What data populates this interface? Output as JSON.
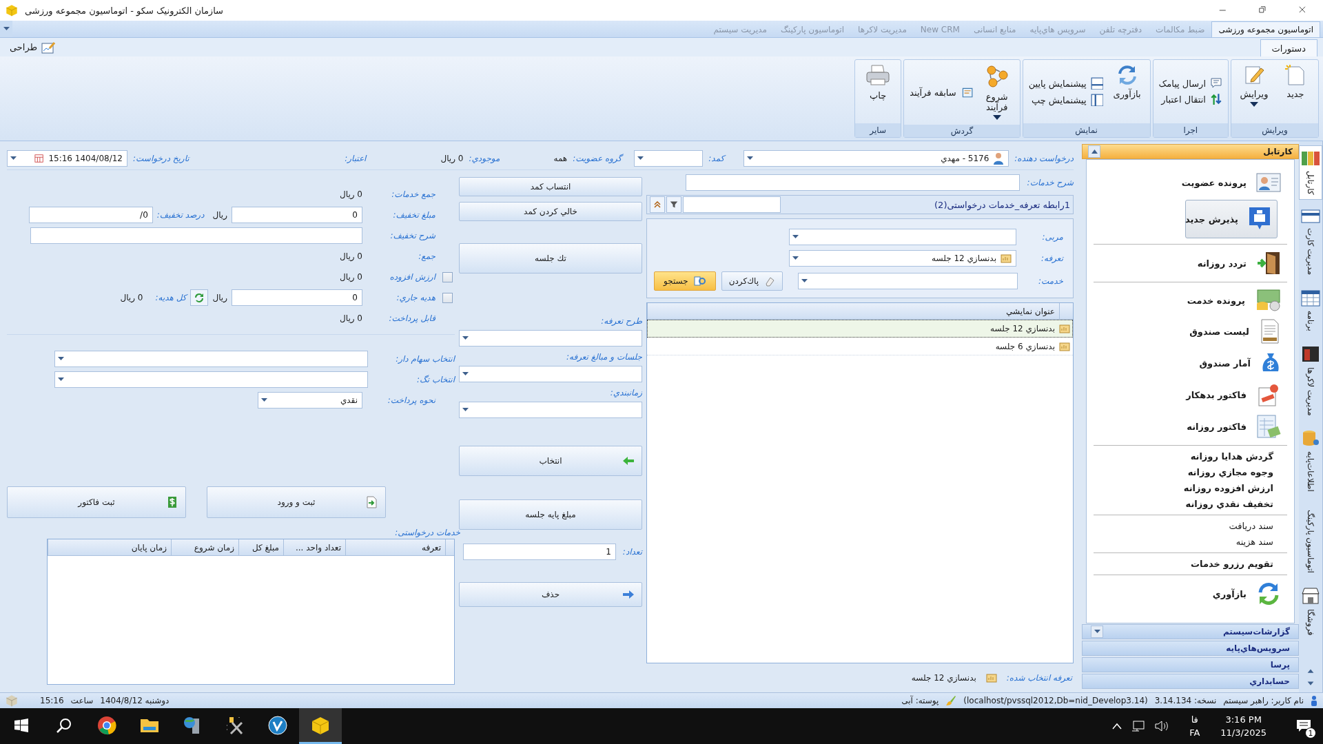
{
  "window": {
    "title": "سازمان الکترونیک سکو - اتوماسیون مجموعه ورزشی"
  },
  "module_tabs": [
    {
      "label": "اتوماسیون مجموعه ورزشی",
      "selected": true
    },
    {
      "label": "ضبط مکالمات",
      "selected": false
    },
    {
      "label": "دفترچه تلفن",
      "selected": false
    },
    {
      "label": "سرویس هاي‌پایه",
      "selected": false
    },
    {
      "label": "منابع انسانی",
      "selected": false
    },
    {
      "label": "New CRM",
      "selected": false
    },
    {
      "label": "مدیریت لاکرها",
      "selected": false
    },
    {
      "label": "اتوماسیون پارکینگ",
      "selected": false
    },
    {
      "label": "مدیریت سیستم",
      "selected": false
    }
  ],
  "ribbon_tabs": [
    {
      "label": "دستورات",
      "selected": true
    }
  ],
  "design_button": "طراحی",
  "ribbon_groups": [
    {
      "title": "ویرایش",
      "items": [
        {
          "kind": "large",
          "label": "جدید",
          "menu": false
        },
        {
          "kind": "large",
          "label": "ویرایش",
          "menu": true
        }
      ]
    },
    {
      "title": "اجرا",
      "items": [
        {
          "kind": "small",
          "label": "ارسال پیامک"
        },
        {
          "kind": "small",
          "label": "انتقال اعتبار"
        }
      ]
    },
    {
      "title": "نمایش",
      "items": [
        {
          "kind": "large",
          "label": "بازآوری",
          "menu": false
        },
        {
          "kind": "small",
          "label": "پیشنمایش پایین"
        },
        {
          "kind": "small",
          "label": "پیشنمایش چپ"
        }
      ]
    },
    {
      "title": "گردش",
      "items": [
        {
          "kind": "large",
          "label": "شروع فرآیند",
          "menu": true
        },
        {
          "kind": "small",
          "label": "سابقه فرآیند"
        }
      ]
    },
    {
      "title": "سایر",
      "items": [
        {
          "kind": "large",
          "label": "چاپ",
          "menu": false
        }
      ]
    }
  ],
  "request": {
    "requester": {
      "label": "درخواست دهنده:",
      "value": "5176 - مهدي"
    },
    "locker": {
      "label": "کمد:"
    },
    "group": {
      "label": "گروه عضویت:",
      "value": "همه"
    },
    "balance": {
      "label": "موجودي:",
      "value": "0 ریال"
    },
    "credit": {
      "label": "اعتبار:"
    },
    "date": {
      "label": "تاریخ درخواست:",
      "value": "1404/08/12 15:16"
    },
    "description": {
      "label": "شرح خدمات:"
    }
  },
  "tariff_grid": {
    "title": "1رابطه تعرفه_خدمات درخواستی(2)",
    "filters": [
      {
        "label": "مربی:"
      },
      {
        "label": "تعرفه:",
        "value": "بدنسازي 12 جلسه"
      },
      {
        "label": "خدمت:"
      }
    ],
    "clear_button": "پاك‌کردن",
    "search_button": "جستجو",
    "column": "عنوان نمایشي",
    "rows": [
      {
        "title": "بدنسازي 12 جلسه",
        "selected": true
      },
      {
        "title": "بدنسازي 6 جلسه",
        "selected": false
      }
    ],
    "selected_label": "تعرفه انتخاب شده:",
    "selected_value": "بدنسازي 12 جلسه"
  },
  "actions": {
    "assign_locker": "انتساب کمد",
    "empty_locker": "خالي کردن کمد",
    "single_session": "تك جلسه",
    "tariff_plan": {
      "label": "طرح تعرفه:"
    },
    "sessions": {
      "label": "جلسات و مبالغ تعرفه:"
    },
    "schedule": {
      "label": "زمانبندي:"
    },
    "select": "انتخاب",
    "base_price": "مبلغ پایه جلسه",
    "count": {
      "label": "تعداد:",
      "value": "1"
    },
    "delete": "حذف"
  },
  "invoice": {
    "services_total": {
      "label": "جمع خدمات:",
      "value": "0 ریال"
    },
    "discount": {
      "label": "مبلغ تخفیف:",
      "value": "0",
      "unit": "ریال"
    },
    "discount_percent": {
      "label": "درصد تخفیف:",
      "value": "0/"
    },
    "discount_note": {
      "label": "شرح تخفیف:"
    },
    "total": {
      "label": "جمع:",
      "value": "0 ریال"
    },
    "vat": {
      "label": "ارزش افزوده",
      "value": "0 ریال",
      "checked": false
    },
    "gift": {
      "label": "هدیه جاري:",
      "value": "0",
      "unit": "ریال",
      "checked": false
    },
    "gift_total": {
      "label": "کل هدیه:",
      "value": "0 ریال"
    },
    "payable": {
      "label": "قابل پرداخت:",
      "value": "0 ریال"
    },
    "shareholder": {
      "label": "انتخاب سهام دار:"
    },
    "tag": {
      "label": "انتخاب تگ:"
    },
    "payment": {
      "label": "نحوه پرداخت:",
      "value": "نقدي"
    },
    "buttons": [
      "ثبت و ورود",
      "ثبت فاکتور"
    ],
    "services_label": "خدمات درخواستی:",
    "columns": [
      "تعرفه",
      "تعداد واحد ...",
      "مبلغ کل",
      "زمان شروع",
      "زمان پایان"
    ]
  },
  "sidebar": {
    "title": "کارتابل",
    "groups": [
      {
        "items": [
          {
            "kind": "large",
            "label": "پرونده عضویت",
            "selected": false
          },
          {
            "kind": "large",
            "label": "پذیرش جدید",
            "selected": true
          }
        ]
      },
      {
        "items": [
          {
            "kind": "large",
            "label": "تردد روزانه",
            "selected": false
          }
        ]
      },
      {
        "items": [
          {
            "kind": "large",
            "label": "پرونده خدمت",
            "selected": false
          },
          {
            "kind": "large",
            "label": "لیست صندوق",
            "selected": false
          },
          {
            "kind": "large",
            "label": "آمار صندوق",
            "selected": false
          },
          {
            "kind": "large",
            "label": "فاکتور بدهکار",
            "selected": false
          },
          {
            "kind": "large",
            "label": "فاکتور روزانه",
            "selected": false
          }
        ]
      },
      {
        "items": [
          {
            "kind": "bold",
            "label": "گردش هدایا روزانه",
            "selected": false
          },
          {
            "kind": "bold",
            "label": "وجوه مجازي روزانه",
            "selected": false
          },
          {
            "kind": "bold",
            "label": "ارزش افزوده روزانه",
            "selected": false
          },
          {
            "kind": "bold",
            "label": "تخفیف نقدي روزانه",
            "selected": false
          }
        ]
      },
      {
        "items": [
          {
            "kind": "plain",
            "label": "سند دریافت",
            "selected": false
          },
          {
            "kind": "plain",
            "label": "سند هزینه",
            "selected": false
          }
        ]
      },
      {
        "items": [
          {
            "kind": "bold",
            "label": "تقویم رزرو خدمات",
            "selected": false
          }
        ]
      },
      {
        "items": [
          {
            "kind": "large",
            "label": "بازآوري",
            "selected": false
          }
        ]
      }
    ],
    "sections": [
      "گزارشات‌سیستم",
      "سرویس‌هاي‌پایه",
      "پرسا",
      "حسابداري"
    ]
  },
  "side_tabs": [
    {
      "label": "کارتابل",
      "selected": true
    },
    {
      "label": "مدیریت کارت",
      "selected": false
    },
    {
      "label": "برنامه",
      "selected": false
    },
    {
      "label": "مدیریت لاکرها",
      "selected": false
    },
    {
      "label": "اطلاعات‌پایه",
      "selected": false
    },
    {
      "label": "اتوماسیون پارکینگ",
      "selected": false
    },
    {
      "label": "فروشگا",
      "selected": false
    }
  ],
  "status_bar": {
    "date": "دوشنبه 1404/8/12",
    "time_label": "ساعت",
    "time": "15:16",
    "user": "نام کاربر: راهبر سیستم",
    "version": "نسخه: 3.14.134",
    "server": "(localhost/pvssql2012,Db=nid_Develop3.14)",
    "skin": "پوسته: آبی"
  },
  "taskbar": {
    "apps": [
      {
        "selected": false
      },
      {
        "selected": false
      },
      {
        "selected": false
      },
      {
        "selected": false
      },
      {
        "selected": false
      },
      {
        "selected": true
      }
    ],
    "language": "فا",
    "language_code": "FA",
    "time": "3:16 PM",
    "date": "11/3/2025",
    "notifications": "1"
  }
}
